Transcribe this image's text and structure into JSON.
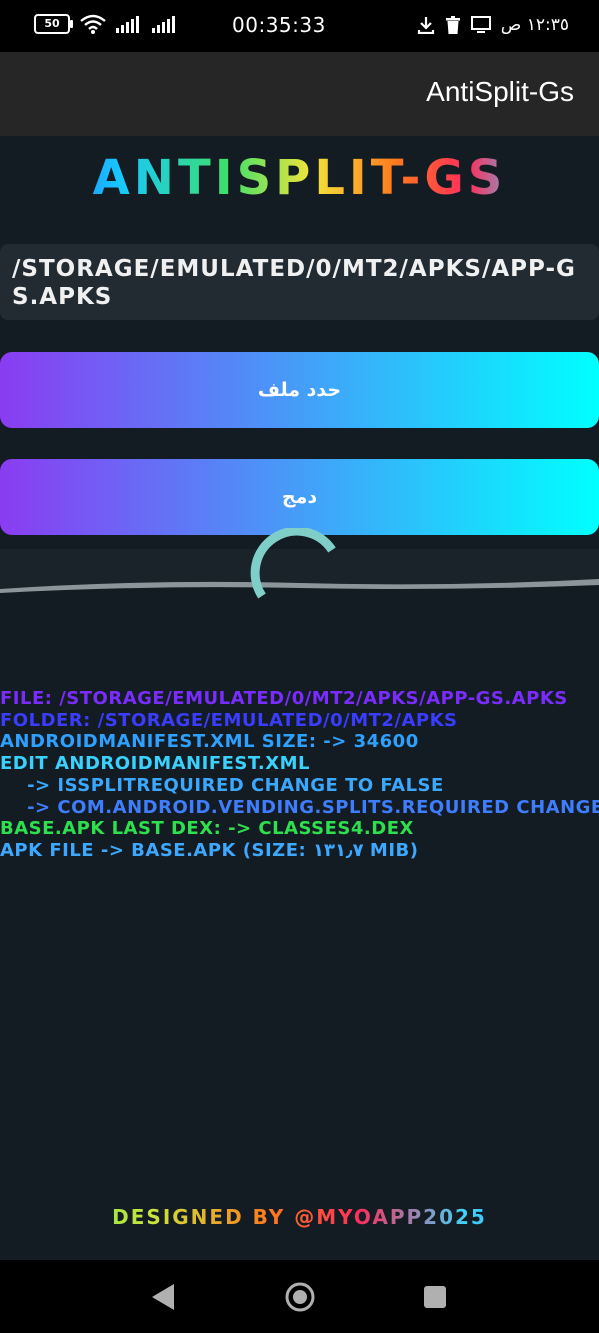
{
  "status_bar": {
    "battery": "50",
    "clock": "00:35:33",
    "right_time": "١٢:٣٥ ص"
  },
  "app_bar": {
    "title": "AntiSplit-Gs"
  },
  "logo": {
    "text": "ANTISPLIT-GS"
  },
  "path": {
    "value": "/storage/emulated/0/MT2/apks/app-gs.apks"
  },
  "buttons": {
    "select_file": "حدد ملف",
    "merge": "دمج"
  },
  "log": [
    {
      "text": "file: /storage/emulated/0/MT2/apks/app-gs.apks",
      "color": "#7a2cff"
    },
    {
      "text": "folder: /storage/emulated/0/MT2/apks",
      "color": "#3a3cff"
    },
    {
      "text": "AndroidManifest.xml size: -> 34600",
      "color": "#2ea0ff"
    },
    {
      "text": "edit AndroidManifest.xml",
      "color": "#3ad1ff"
    },
    {
      "text": "    -> isSplitRequired change to false",
      "color": "#3aa8ff"
    },
    {
      "text": "    -> com.android.vending.splits.required change",
      "color": "#3f7dff"
    },
    {
      "text": "base.apk last dex: -> classes4.dex",
      "color": "#2ee04e"
    },
    {
      "text": "apk file -> base.apk (size: ١٣١٫٧ MiB)",
      "color": "#3da8ff"
    }
  ],
  "footer": {
    "text": "Designed by @MYOAPP2025"
  },
  "colors": {
    "background": "#131c22",
    "app_bar": "#262626",
    "button_gradient_start": "#8a3cf2",
    "button_gradient_end": "#00ffff",
    "spinner": "#7fcfc8"
  }
}
